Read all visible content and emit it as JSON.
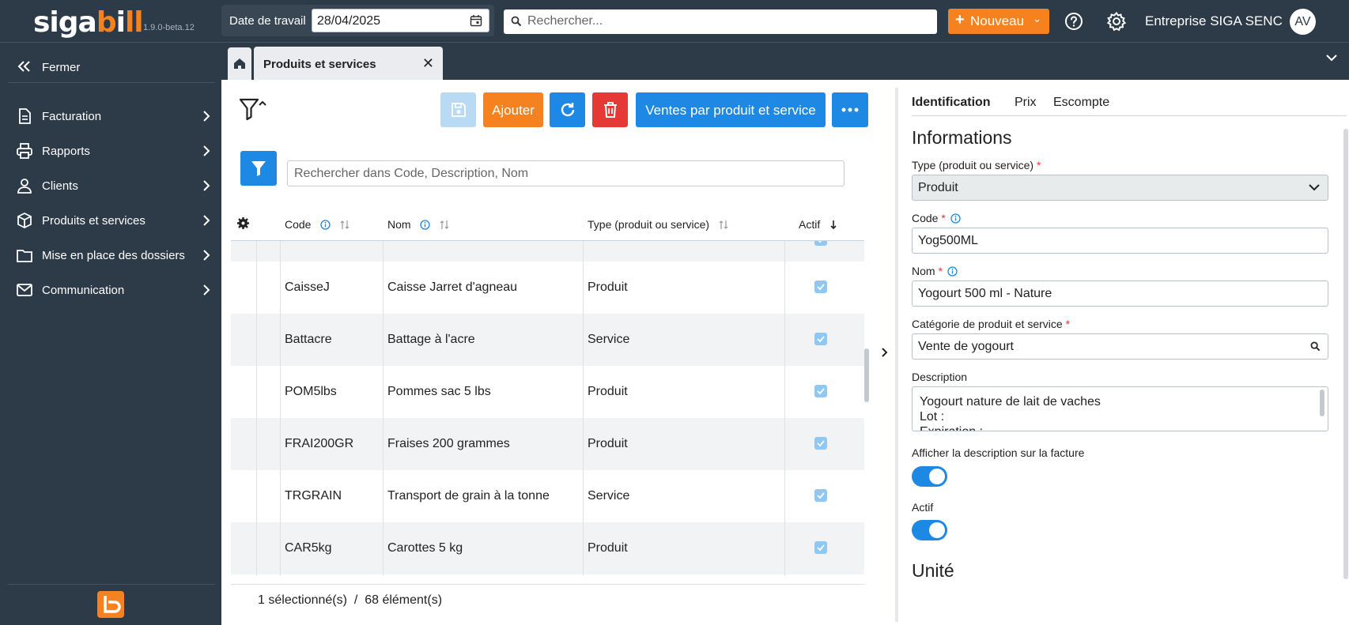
{
  "app": {
    "logo_left": "sig",
    "logo_mid": "a",
    "logo_bill_b": "b",
    "logo_bill_i": "i",
    "logo_bill_rest": "ll",
    "version": "1.9.0-beta.12",
    "work_date_label": "Date de travail",
    "work_date_value": "28/04/2025",
    "search_placeholder": "Rechercher...",
    "new_button": "Nouveau",
    "company": "Entreprise SIGA SENC",
    "avatar_initials": "AV",
    "accent_color": "#f5821f",
    "primary_color": "#1e88e5"
  },
  "sidebar": {
    "close_label": "Fermer",
    "items": [
      {
        "label": "Facturation",
        "icon": "invoice-icon"
      },
      {
        "label": "Rapports",
        "icon": "printer-icon"
      },
      {
        "label": "Clients",
        "icon": "user-icon"
      },
      {
        "label": "Produits et services",
        "icon": "box-icon"
      },
      {
        "label": "Mise en place des dossiers",
        "icon": "folder-icon"
      },
      {
        "label": "Communication",
        "icon": "mail-icon"
      }
    ]
  },
  "tabs": {
    "active_label": "Produits et services"
  },
  "toolbar": {
    "add_label": "Ajouter",
    "sales_label": "Ventes par produit et service",
    "search_placeholder": "Rechercher dans Code, Description, Nom"
  },
  "grid": {
    "columns": [
      "Code",
      "Nom",
      "Type (produit ou service)",
      "Actif"
    ],
    "rows": [
      {
        "code": "CaisseJ",
        "name": "Caisse Jarret d'agneau",
        "type": "Produit",
        "active": true
      },
      {
        "code": "Battacre",
        "name": "Battage à l'acre",
        "type": "Service",
        "active": true
      },
      {
        "code": "POM5lbs",
        "name": "Pommes sac 5 lbs",
        "type": "Produit",
        "active": true
      },
      {
        "code": "FRAI200GR",
        "name": "Fraises 200 grammes",
        "type": "Produit",
        "active": true
      },
      {
        "code": "TRGRAIN",
        "name": "Transport de grain à la tonne",
        "type": "Service",
        "active": true
      },
      {
        "code": "CAR5kg",
        "name": "Carottes 5 kg",
        "type": "Produit",
        "active": true
      }
    ],
    "footer_selected": "1",
    "footer_selected_label": "sélectionné(s)",
    "footer_sep": "/",
    "footer_total": "68",
    "footer_total_label": "élément(s)"
  },
  "detail": {
    "tabs": [
      "Identification",
      "Prix",
      "Escompte"
    ],
    "section_title": "Informations",
    "type_label": "Type (produit ou service)",
    "type_value": "Produit",
    "code_label": "Code",
    "code_value": "Yog500ML",
    "name_label": "Nom",
    "name_value": "Yogourt 500 ml - Nature",
    "category_label": "Catégorie de produit et service",
    "category_value": "Vente de yogourt",
    "description_label": "Description",
    "description_lines": [
      "Yogourt nature de lait de vaches",
      "Lot :",
      "Expiration :"
    ],
    "show_desc_label": "Afficher la description sur la facture",
    "show_desc_on": true,
    "active_label": "Actif",
    "active_on": true,
    "unit_title": "Unité"
  }
}
